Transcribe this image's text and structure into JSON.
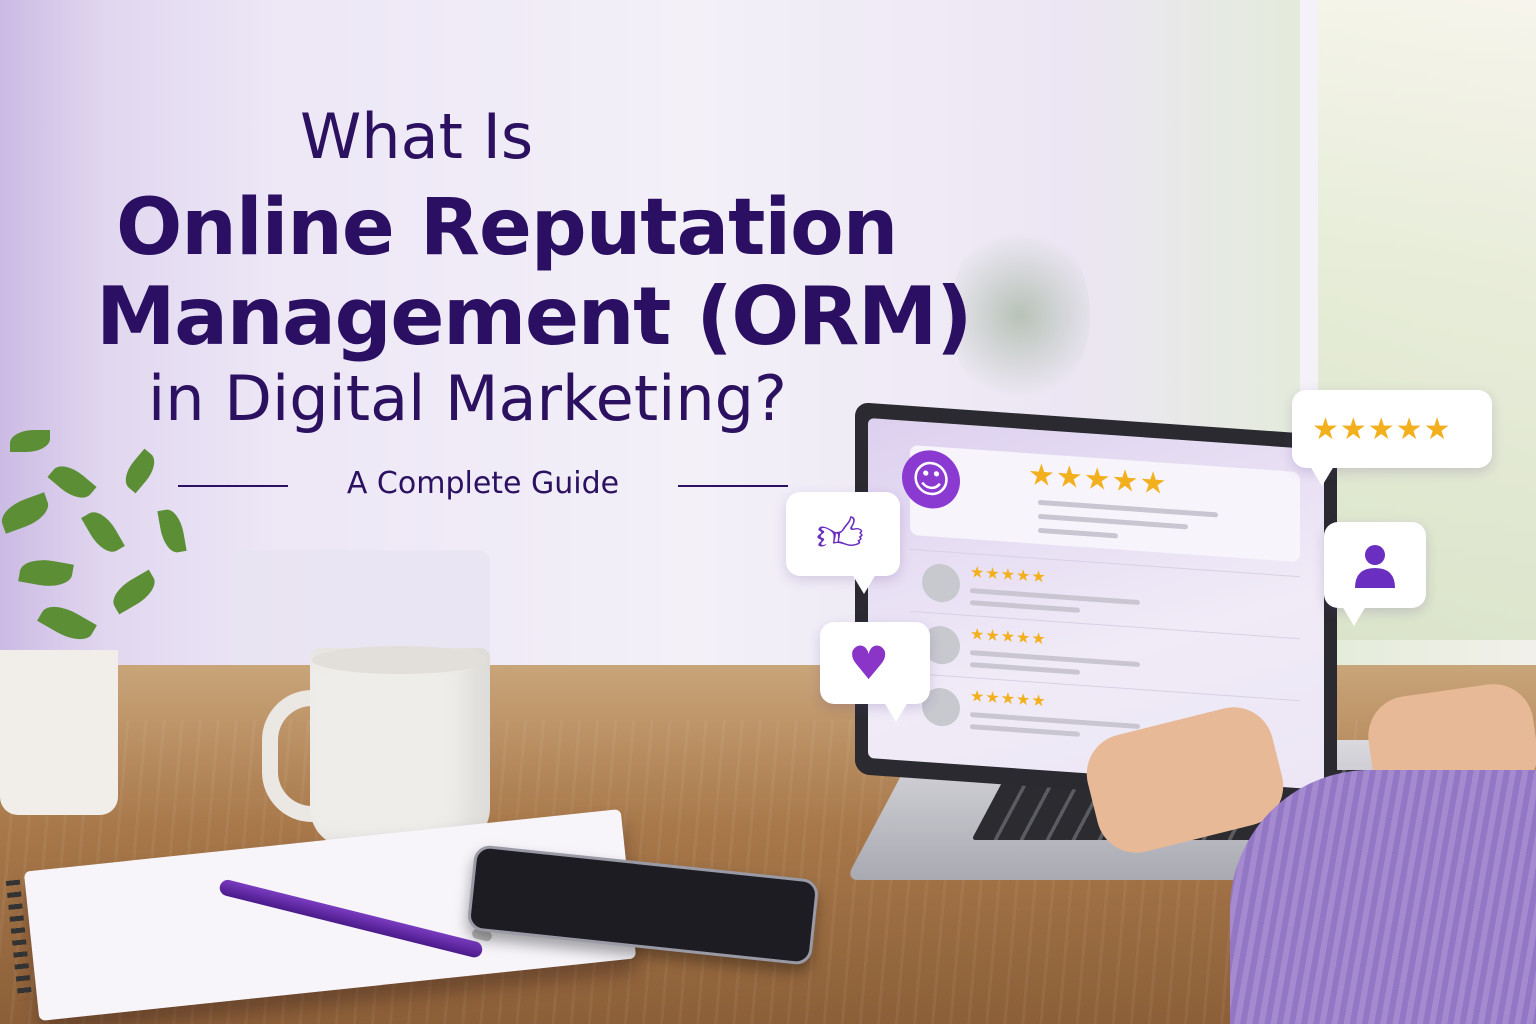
{
  "headline": {
    "line1": "What Is",
    "line2": "Online Reputation",
    "line3": "Management (ORM)",
    "line4": "in Digital Marketing?",
    "subtitle": "A Complete Guide"
  },
  "laptop_reviews": {
    "featured_stars": "★★★★★",
    "rows": [
      {
        "stars": "★★★★★"
      },
      {
        "stars": "★★★★★"
      },
      {
        "stars": "★★★★★"
      }
    ]
  },
  "bubbles": {
    "top_right_stars": "★★★★★",
    "like_icon": "thumbs-up-icon",
    "heart_icon": "heart-icon",
    "user_icon": "user-icon"
  },
  "colors": {
    "title": "#2b0f62",
    "accent_purple": "#7a3cc0",
    "star_gold": "#f2b01e"
  }
}
